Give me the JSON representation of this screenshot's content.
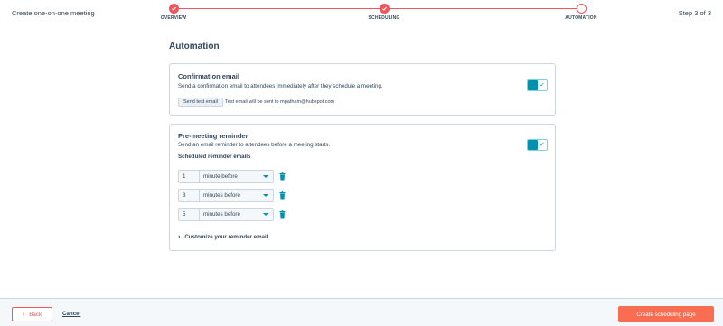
{
  "header": {
    "title": "Create one-on-one meeting",
    "step_count": "Step 3 of 3",
    "steps": [
      {
        "label": "OVERVIEW",
        "state": "complete"
      },
      {
        "label": "SCHEDULING",
        "state": "complete"
      },
      {
        "label": "AUTOMATION",
        "state": "active"
      }
    ]
  },
  "main": {
    "title": "Automation",
    "confirmation": {
      "heading": "Confirmation email",
      "description": "Send a confirmation email to attendees immediately after they schedule a meeting.",
      "enabled": true,
      "test_button": "Send test email",
      "test_note": "Test email will be sent to mpatham@hubspot.com"
    },
    "reminder": {
      "heading": "Pre-meeting reminder",
      "description": "Send an email reminder to attendees before a meeting starts.",
      "enabled": true,
      "subheading": "Scheduled reminder emails",
      "rows": [
        {
          "value": "1",
          "unit": "minute before"
        },
        {
          "value": "3",
          "unit": "minutes before"
        },
        {
          "value": "5",
          "unit": "minutes before"
        }
      ],
      "customize_label": "Customize your reminder email"
    }
  },
  "footer": {
    "back_label": "Back",
    "cancel_label": "Cancel",
    "create_label": "Create scheduling page"
  },
  "colors": {
    "accent": "#f2545b",
    "primary_button": "#f96d53",
    "toggle": "#0091ae",
    "text": "#33475b"
  }
}
